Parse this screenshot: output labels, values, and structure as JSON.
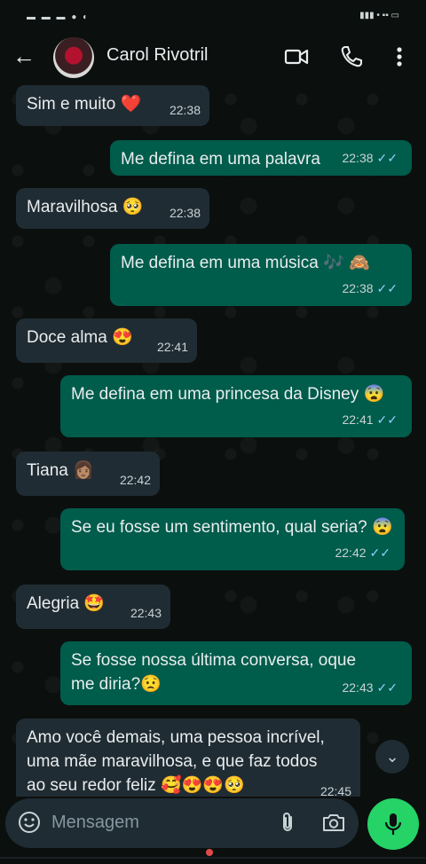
{
  "header": {
    "contact_name": "Carol Rivotril",
    "icons": [
      "back-arrow-icon",
      "video-call-icon",
      "phone-icon",
      "more-vert-icon"
    ]
  },
  "messages": [
    {
      "dir": "in",
      "text": "Sim e muito ❤️",
      "time": "22:38"
    },
    {
      "dir": "out",
      "text": "Me defina em uma palavra",
      "time": "22:38"
    },
    {
      "dir": "in",
      "text": "Maravilhosa 🥺",
      "time": "22:38"
    },
    {
      "dir": "out",
      "text": "Me defina em uma música 🎶 🙈",
      "time": "22:38"
    },
    {
      "dir": "in",
      "text": "Doce alma 😍",
      "time": "22:41"
    },
    {
      "dir": "out",
      "text": "Me defina em uma princesa da Disney 😨",
      "time": "22:41"
    },
    {
      "dir": "in",
      "text": "Tiana 👩🏽",
      "time": "22:42"
    },
    {
      "dir": "out",
      "text": "Se eu fosse um sentimento, qual seria? 😨",
      "time": "22:42"
    },
    {
      "dir": "in",
      "text": "Alegria 🤩",
      "time": "22:43"
    },
    {
      "dir": "out",
      "text": "Se fosse nossa última conversa, oque me diria?😟",
      "time": "22:43"
    },
    {
      "dir": "in",
      "text": "Amo você demais, uma pessoa incrível, uma mãe maravilhosa, e que faz todos ao seu redor feliz 🥰😍😍🥺",
      "time": "22:45"
    }
  ],
  "composer": {
    "placeholder": "Mensagem"
  },
  "colors": {
    "incoming_bubble": "#202c33",
    "outgoing_bubble": "#005c4b",
    "accent_green": "#25d366",
    "read_ticks": "#8fd0ff"
  }
}
